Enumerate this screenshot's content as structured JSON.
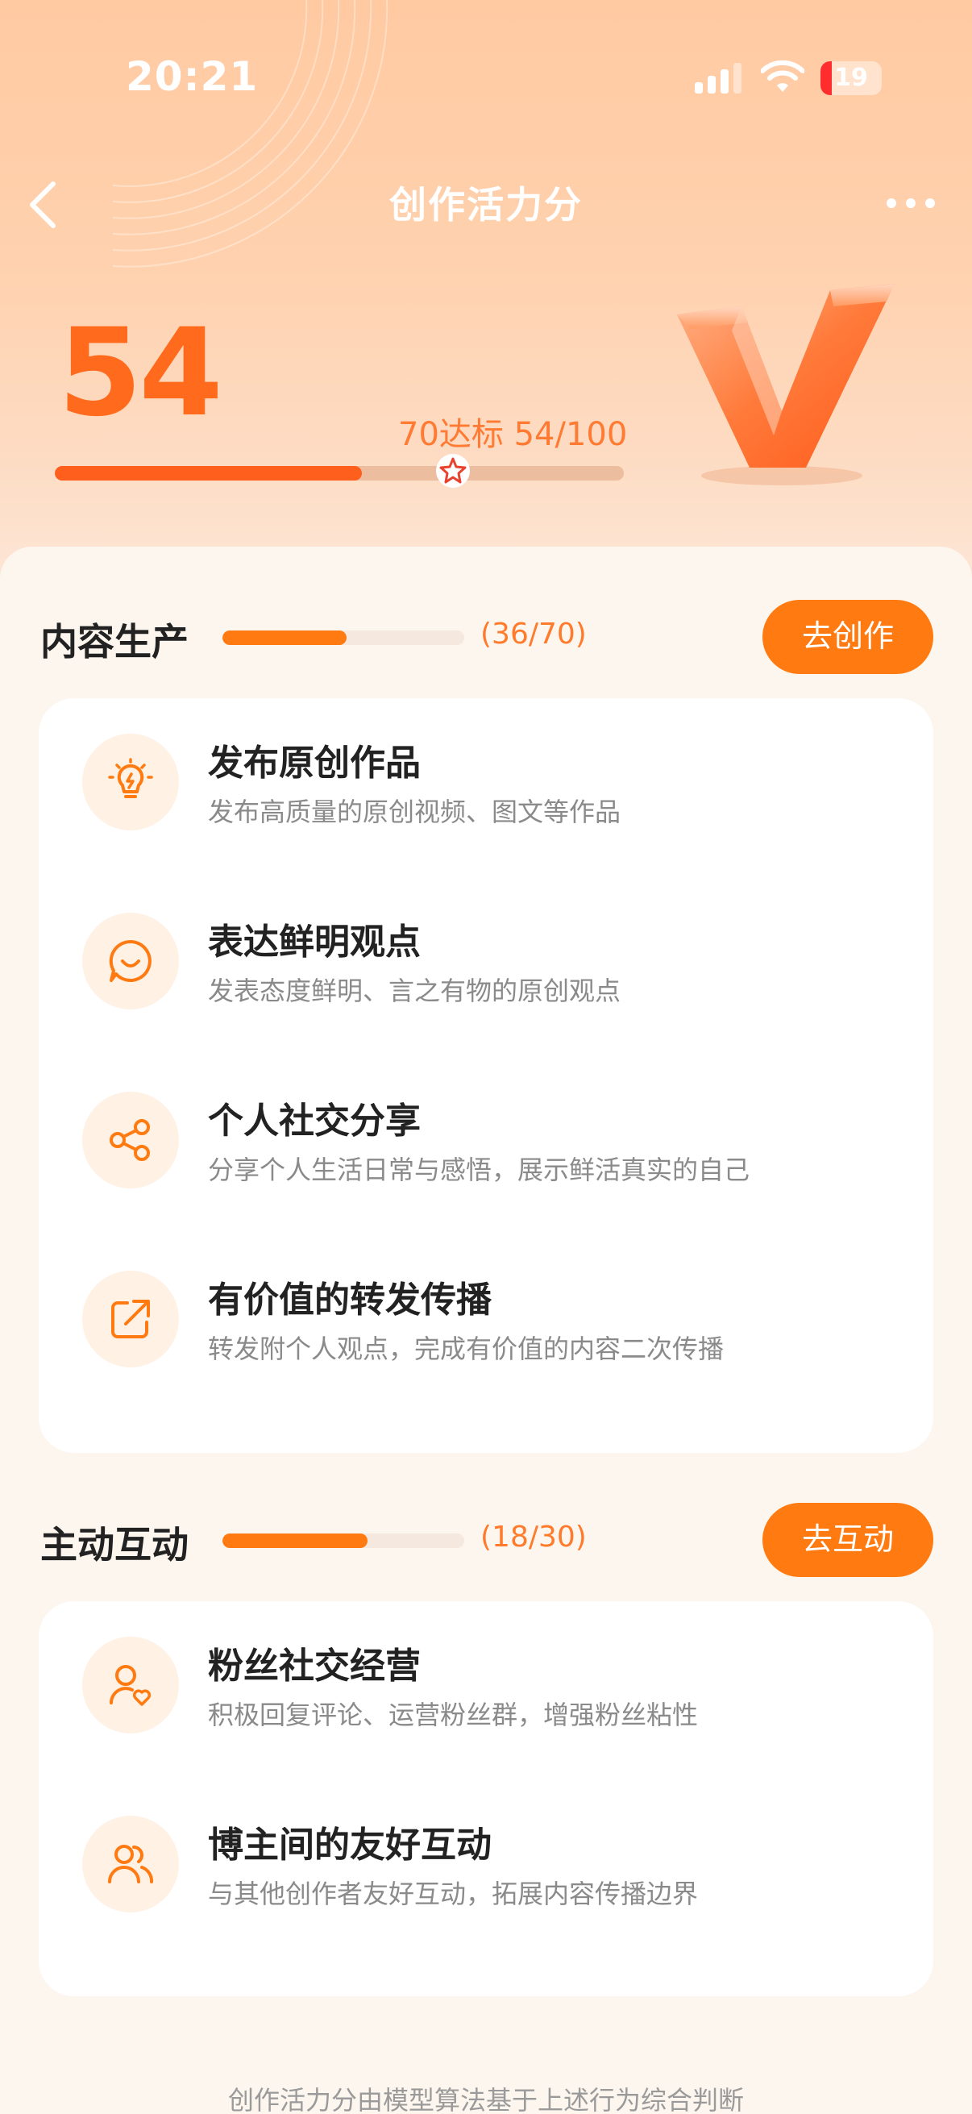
{
  "status_bar": {
    "time": "20:21",
    "battery": "19"
  },
  "nav": {
    "title": "创作活力分"
  },
  "score": {
    "value": "54",
    "goal_text": "70达标 54/100",
    "progress": 0.54,
    "goal_fraction": 0.7
  },
  "sections": [
    {
      "title": "内容生产",
      "count": "(36/70)",
      "progress": 0.514,
      "button": "去创作",
      "items": [
        {
          "title": "发布原创作品",
          "desc": "发布高质量的原创视频、图文等作品",
          "icon": "lightbulb-icon"
        },
        {
          "title": "表达鲜明观点",
          "desc": "发表态度鲜明、言之有物的原创观点",
          "icon": "smile-chat-icon"
        },
        {
          "title": "个人社交分享",
          "desc": "分享个人生活日常与感悟，展示鲜活真实的自己",
          "icon": "share-icon"
        },
        {
          "title": "有价值的转发传播",
          "desc": "转发附个人观点，完成有价值的内容二次传播",
          "icon": "forward-icon"
        }
      ]
    },
    {
      "title": "主动互动",
      "count": "(18/30)",
      "progress": 0.6,
      "button": "去互动",
      "items": [
        {
          "title": "粉丝社交经营",
          "desc": "积极回复评论、运营粉丝群，增强粉丝粘性",
          "icon": "user-heart-icon"
        },
        {
          "title": "博主间的友好互动",
          "desc": "与其他创作者友好互动，拓展内容传播边界",
          "icon": "users-icon"
        }
      ]
    }
  ],
  "footer": {
    "text": "创作活力分由模型算法基于上述行为综合判断"
  },
  "colors": {
    "accent": "#ff7a10",
    "score": "#ff6a1c",
    "hero_bg": "#ffcaa2"
  }
}
